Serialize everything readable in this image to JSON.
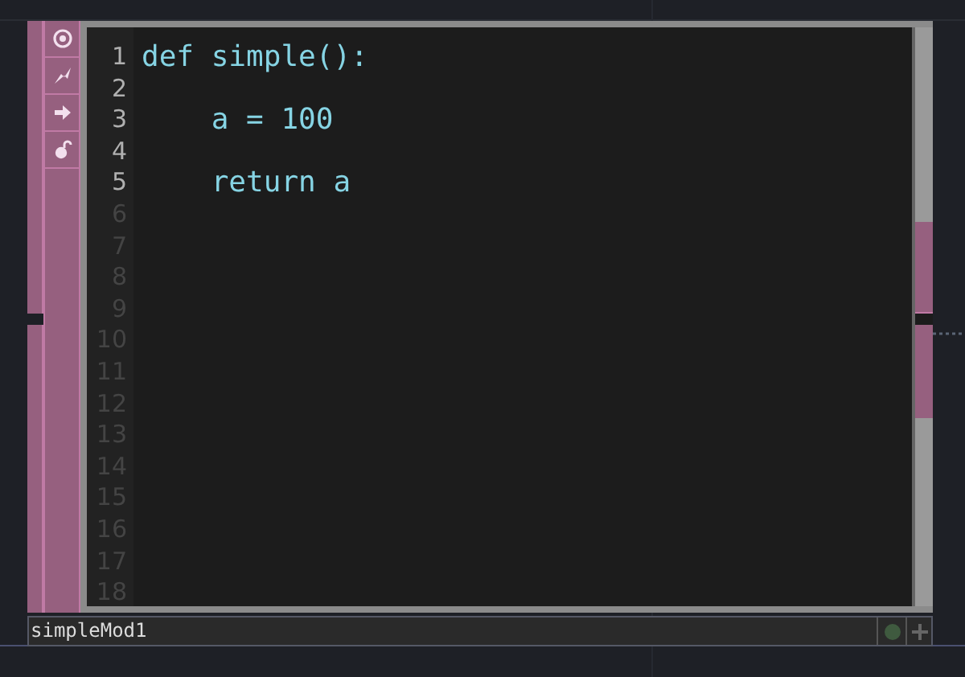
{
  "editor": {
    "lines": [
      {
        "number": "1",
        "text": "def simple():",
        "kind": "code"
      },
      {
        "number": "2",
        "kind": "code"
      },
      {
        "number": "3",
        "text": "    a = 100",
        "kind": "code"
      },
      {
        "number": "4",
        "kind": "code"
      },
      {
        "number": "5",
        "text": "    return a",
        "kind": "code"
      },
      {
        "number": "6",
        "kind": "empty"
      },
      {
        "number": "7",
        "kind": "empty"
      },
      {
        "number": "8",
        "kind": "empty"
      },
      {
        "number": "9",
        "kind": "empty"
      },
      {
        "number": "10",
        "kind": "empty"
      },
      {
        "number": "11",
        "kind": "empty"
      },
      {
        "number": "12",
        "kind": "empty"
      },
      {
        "number": "13",
        "kind": "empty"
      },
      {
        "number": "14",
        "kind": "empty"
      },
      {
        "number": "15",
        "kind": "empty"
      },
      {
        "number": "16",
        "kind": "empty"
      },
      {
        "number": "17",
        "kind": "empty"
      },
      {
        "number": "18",
        "kind": "empty"
      }
    ]
  },
  "node": {
    "name": "simpleMod1"
  }
}
